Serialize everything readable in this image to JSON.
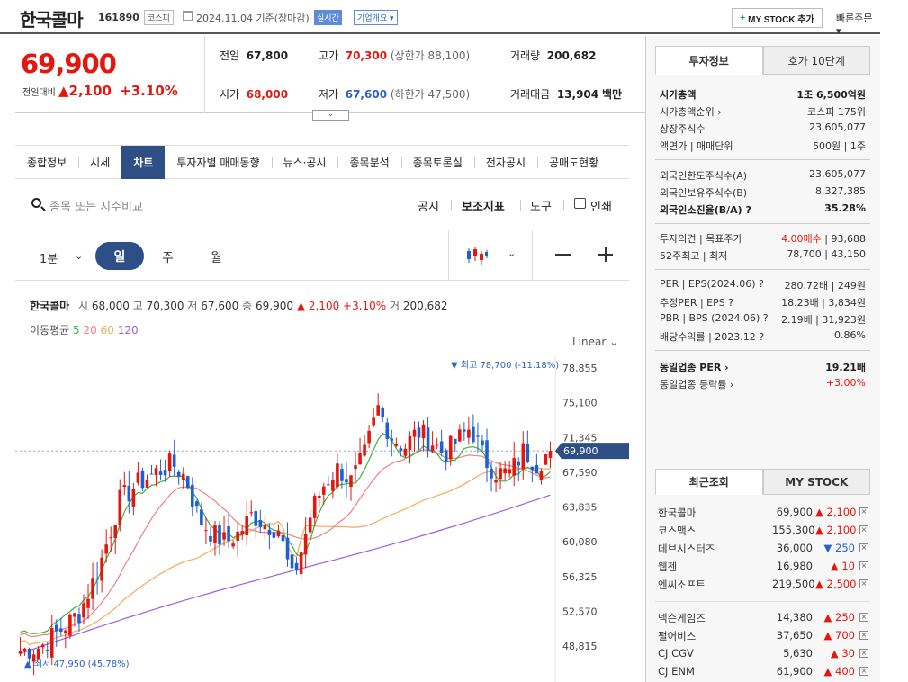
{
  "header": {
    "name": "한국콜마",
    "code": "161890",
    "market": "코스피",
    "date": "2024.11.04  기준(장마감)",
    "realtime": "실시간",
    "corp_info": "기업개요 ▾",
    "mystock_label": "MY STOCK 추가",
    "mystock_plus": "+",
    "quick_order": "빠른주문 ▾"
  },
  "price": {
    "current": "69,900",
    "change_label": "전일대비",
    "change": "▲2,100",
    "change_pct": "+3.10%"
  },
  "summary": {
    "prev_label": "전일",
    "prev": "67,800",
    "high_label": "고가",
    "high": "70,300",
    "upper_limit": "(상한가 88,100)",
    "volume_label": "거래량",
    "volume": "200,682",
    "open_label": "시가",
    "open": "68,000",
    "low_label": "저가",
    "low": "67,600",
    "lower_limit": "(하한가 47,500)",
    "value_label": "거래대금",
    "value": "13,904",
    "value_unit": "백만"
  },
  "expand_icon": "chevron-down",
  "tabs": [
    "종합정보",
    "시세",
    "차트",
    "투자자별 매매동향",
    "뉴스·공시",
    "종목분석",
    "종목토론실",
    "전자공시",
    "공매도현황"
  ],
  "active_tab": "차트",
  "search": {
    "placeholder": "종목 또는 지수비교",
    "tools": [
      "공시",
      "보조지표",
      "도구",
      "인쇄"
    ]
  },
  "period": {
    "minute": "1분",
    "day": "일",
    "week": "주",
    "month": "월"
  },
  "ohlc_line": {
    "name": "한국콜마",
    "open_label": "시",
    "open": "68,000",
    "high_label": "고",
    "high": "70,300",
    "low_label": "저",
    "low": "67,600",
    "close_label": "종",
    "close": "69,900",
    "change": "▲ 2,100 +3.10%",
    "volume_label": "거",
    "volume": "200,682"
  },
  "ma_line": {
    "label": "이동평균",
    "p5": "5",
    "p20": "20",
    "p60": "60",
    "p120": "120"
  },
  "scale_mode": "Linear",
  "colors": {
    "up": "#e4170f",
    "down": "#1f5fd6",
    "ma5": "#3cb043",
    "ma20": "#f08080",
    "ma60": "#f5a95b",
    "ma120": "#a05fe0",
    "accent": "#2e4e86"
  },
  "chart_data": {
    "type": "candlestick",
    "y_ticks": [
      "78,855",
      "75,100",
      "71,345",
      "67,590",
      "63,835",
      "60,080",
      "56,325",
      "52,570",
      "48,815"
    ],
    "ylim": [
      47000,
      80000
    ],
    "last_price_label": "69,900",
    "max_annotation": "▼ 최고 78,700 (-11.18%)",
    "min_annotation": "▲ 최저 47,950 (45.78%)",
    "last_close": 69900,
    "max_value": 78700,
    "min_value": 47950
  },
  "right_panel": {
    "tab_info": "투자정보",
    "tab_ask": "호가 10단계",
    "rows1": [
      {
        "k": "시가총액",
        "v": "1조 6,500억원",
        "bold": true
      },
      {
        "k": "시가총액순위 ›",
        "v": "코스피 175위"
      },
      {
        "k": "상장주식수",
        "v": "23,605,077"
      },
      {
        "k": "액면가 | 매매단위",
        "v": "500원 | 1주"
      }
    ],
    "rows2": [
      {
        "k": "외국인한도주식수(A)",
        "v": "23,605,077"
      },
      {
        "k": "외국인보유주식수(B)",
        "v": "8,327,385"
      },
      {
        "k": "외국인소진율(B/A) ?",
        "v": "35.28%",
        "bold": true
      }
    ],
    "rows3": [
      {
        "k": "투자의견 | 목표주가",
        "v1": "4.00매수",
        "v2": " | 93,688"
      },
      {
        "k": "52주최고 | 최저",
        "v": "78,700 | 43,150"
      }
    ],
    "rows4": [
      {
        "k": "PER | EPS(2024.06) ?",
        "v": "280.72배 | 249원"
      },
      {
        "k": "추정PER | EPS ?",
        "v": "18.23배 | 3,834원"
      },
      {
        "k": "PBR | BPS (2024.06) ?",
        "v": "2.19배 | 31,923원"
      },
      {
        "k": "배당수익률 | 2023.12 ?",
        "v": "0.86%"
      }
    ],
    "rows5": [
      {
        "k": "동일업종 PER ›",
        "v": "19.21배",
        "bold": true
      },
      {
        "k": "동일업종 등락률 ›",
        "v": "+3.00%",
        "red": true
      }
    ],
    "tab_recent": "최근조회",
    "tab_mystock": "MY STOCK",
    "recent": [
      {
        "name": "한국콜마",
        "price": "69,900",
        "chg": "▲ 2,100",
        "dir": "up"
      },
      {
        "name": "코스맥스",
        "price": "155,300",
        "chg": "▲ 2,100",
        "dir": "up"
      },
      {
        "name": "데브시스터즈",
        "price": "36,000",
        "chg": "▼ 250",
        "dir": "dn"
      },
      {
        "name": "웹젠",
        "price": "16,980",
        "chg": "▲ 10",
        "dir": "up"
      },
      {
        "name": "엔씨소프트",
        "price": "219,500",
        "chg": "▲ 2,500",
        "dir": "up"
      }
    ],
    "recent2": [
      {
        "name": "넥슨게임즈",
        "price": "14,380",
        "chg": "▲ 250",
        "dir": "up"
      },
      {
        "name": "펄어비스",
        "price": "37,650",
        "chg": "▲ 700",
        "dir": "up"
      },
      {
        "name": "CJ CGV",
        "price": "5,630",
        "chg": "▲ 30",
        "dir": "up"
      },
      {
        "name": "CJ ENM",
        "price": "61,900",
        "chg": "▲ 400",
        "dir": "up"
      }
    ],
    "close_x": "×"
  }
}
